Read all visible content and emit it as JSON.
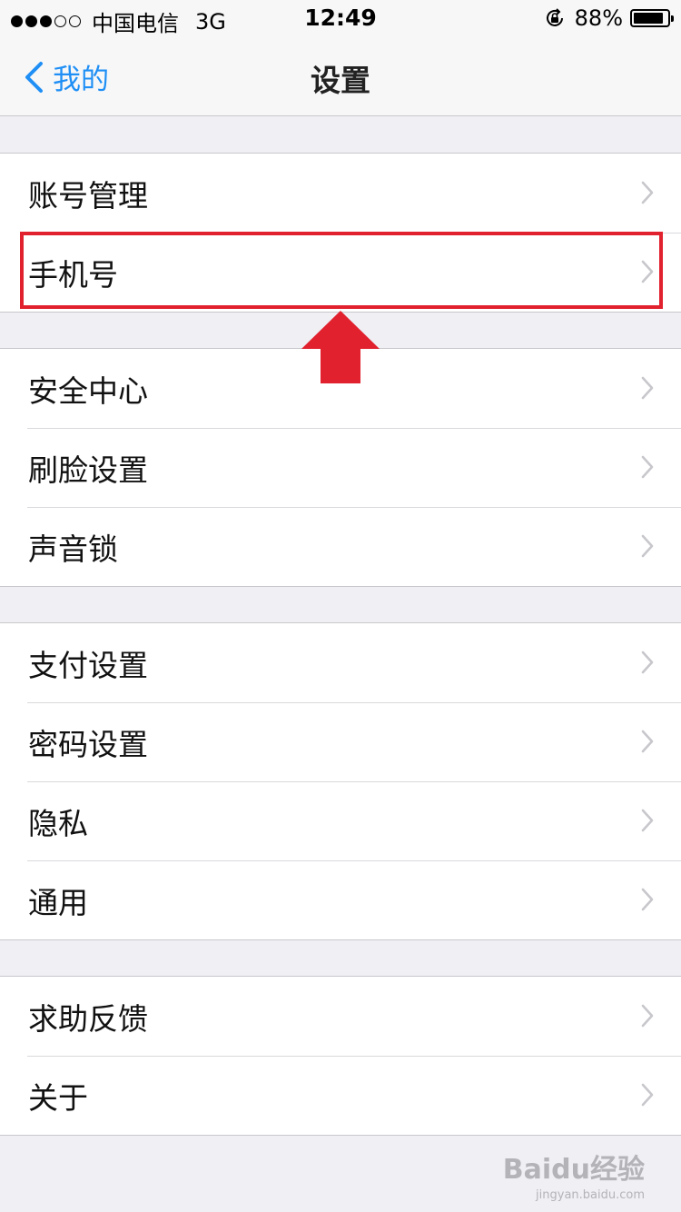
{
  "status_bar": {
    "signal_dots": [
      true,
      true,
      true,
      false,
      false
    ],
    "carrier": "中国电信",
    "network": "3G",
    "time": "12:49",
    "battery_percent": "88%",
    "battery_level": 0.88
  },
  "nav": {
    "back_label": "我的",
    "title": "设置",
    "accent_color": "#1f8ff5"
  },
  "groups": [
    {
      "items": [
        {
          "label": "账号管理"
        },
        {
          "label": "手机号"
        }
      ]
    },
    {
      "items": [
        {
          "label": "安全中心"
        },
        {
          "label": "刷脸设置"
        },
        {
          "label": "声音锁"
        }
      ]
    },
    {
      "items": [
        {
          "label": "支付设置"
        },
        {
          "label": "密码设置"
        },
        {
          "label": "隐私"
        },
        {
          "label": "通用"
        }
      ]
    },
    {
      "items": [
        {
          "label": "求助反馈"
        },
        {
          "label": "关于"
        }
      ]
    }
  ],
  "annotation": {
    "color": "#e1212e",
    "highlighted_item": "手机号"
  },
  "watermark": {
    "brand": "Baidu经验",
    "url": "jingyan.baidu.com"
  }
}
